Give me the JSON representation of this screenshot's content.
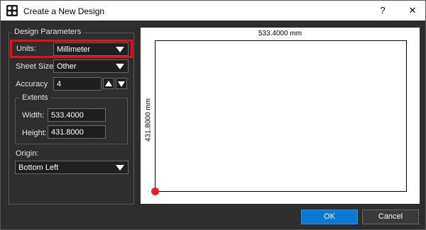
{
  "window": {
    "title": "Create a New Design",
    "help_glyph": "?",
    "close_glyph": "✕"
  },
  "params": {
    "group_label": "Design Parameters",
    "units_label": "Units:",
    "units_value": "Millimeter",
    "sheet_label": "Sheet Size:",
    "sheet_value": "Other",
    "accuracy_label": "Accuracy",
    "accuracy_value": "4",
    "extents_label": "Extents",
    "width_label": "Width:",
    "width_value": "533.4000",
    "height_label": "Height:",
    "height_value": "431.8000",
    "origin_label": "Origin:",
    "origin_value": "Bottom Left"
  },
  "preview": {
    "width_dim": "533.4000 mm",
    "height_dim": "431.8000 mm"
  },
  "buttons": {
    "ok": "OK",
    "cancel": "Cancel"
  },
  "colors": {
    "highlight": "#e0141e",
    "ok_button": "#0a78d4",
    "origin_marker": "#ee1c24"
  }
}
